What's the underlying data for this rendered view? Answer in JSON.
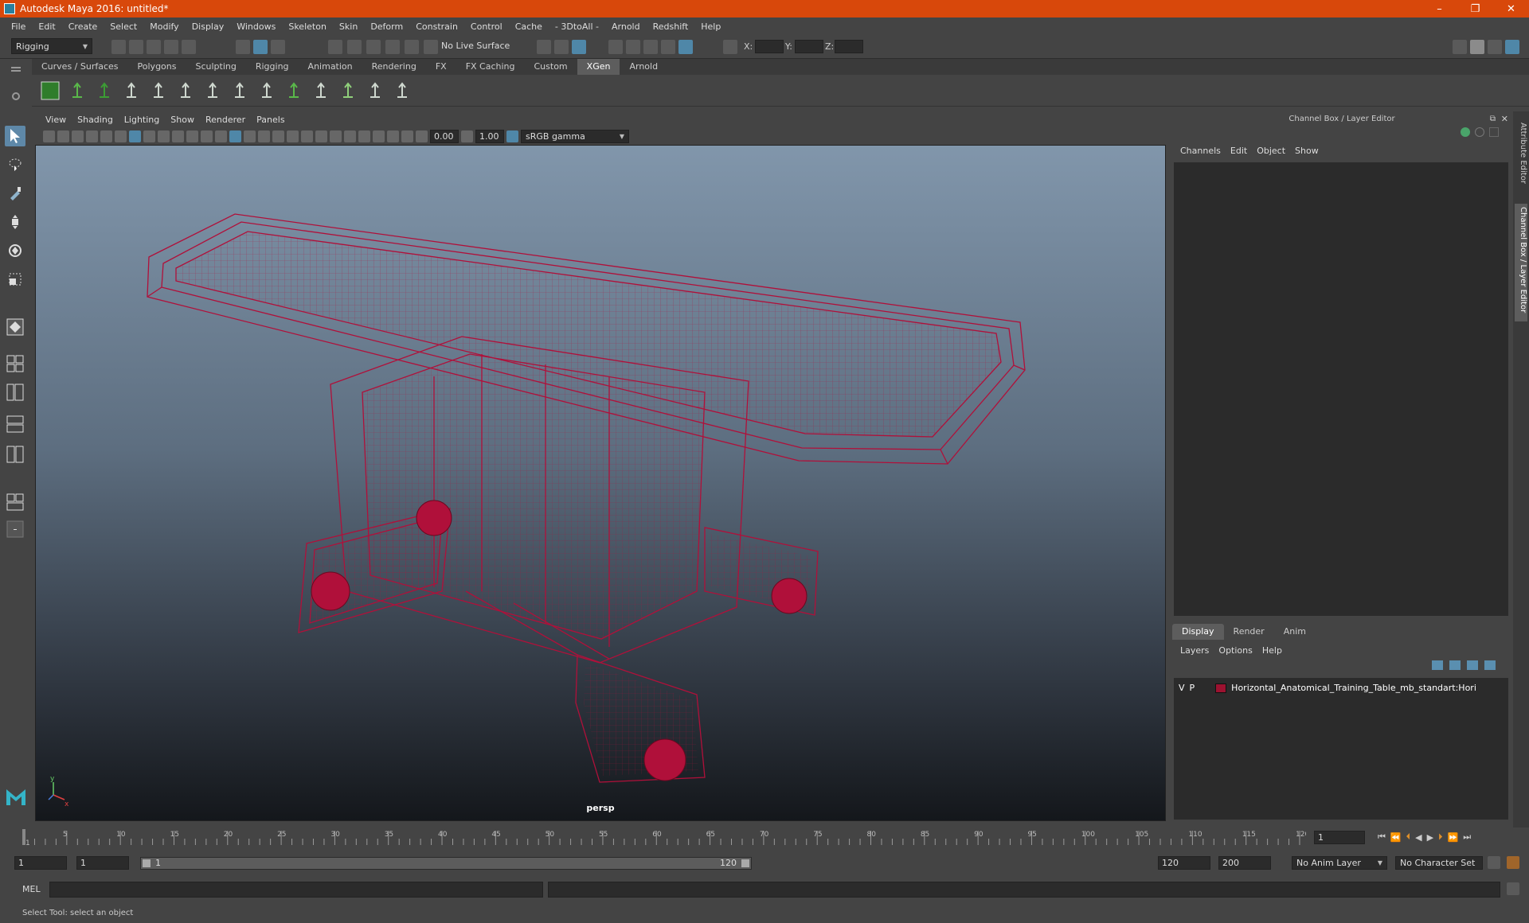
{
  "window": {
    "title": "Autodesk Maya 2016: untitled*",
    "minimize": "–",
    "restore": "❐",
    "close": "✕"
  },
  "menu": [
    "File",
    "Edit",
    "Create",
    "Select",
    "Modify",
    "Display",
    "Windows",
    "Skeleton",
    "Skin",
    "Deform",
    "Constrain",
    "Control",
    "Cache",
    "- 3DtoAll -",
    "Arnold",
    "Redshift",
    "Help"
  ],
  "status_line": {
    "menu_set": "Rigging",
    "live_surface": "No Live Surface",
    "x_label": "X:",
    "y_label": "Y:",
    "z_label": "Z:"
  },
  "shelf_tabs": [
    {
      "label": "Curves / Surfaces",
      "active": false
    },
    {
      "label": "Polygons",
      "active": false
    },
    {
      "label": "Sculpting",
      "active": false
    },
    {
      "label": "Rigging",
      "active": false
    },
    {
      "label": "Animation",
      "active": false
    },
    {
      "label": "Rendering",
      "active": false
    },
    {
      "label": "FX",
      "active": false
    },
    {
      "label": "FX Caching",
      "active": false
    },
    {
      "label": "Custom",
      "active": false
    },
    {
      "label": "XGen",
      "active": true
    },
    {
      "label": "Arnold",
      "active": false
    }
  ],
  "shelf_icons": [
    "xgen-editor-icon",
    "xgen-preview-icon",
    "xgen-description-icon",
    "add-guide-icon",
    "append-guide-icon",
    "guide-normal-icon",
    "sculpt-guide-icon",
    "lock-guide-icon",
    "guide-tools-icon",
    "region-map-icon",
    "groom-icon",
    "clumping-icon",
    "cut-icon",
    "noise-icon"
  ],
  "viewport": {
    "menu": [
      "View",
      "Shading",
      "Lighting",
      "Show",
      "Renderer",
      "Panels"
    ],
    "exposure": "0.00",
    "gamma": "1.00",
    "color_space": "sRGB gamma",
    "camera": "persp",
    "wire_color": "#b0103a"
  },
  "channel_box": {
    "header": "Channel Box / Layer Editor",
    "menu": [
      "Channels",
      "Edit",
      "Object",
      "Show"
    ]
  },
  "layer_editor": {
    "tabs": [
      {
        "label": "Display",
        "active": true
      },
      {
        "label": "Render",
        "active": false
      },
      {
        "label": "Anim",
        "active": false
      }
    ],
    "menu": [
      "Layers",
      "Options",
      "Help"
    ],
    "layers": [
      {
        "visible": "V",
        "playback": "P",
        "color": "#9c1230",
        "name": "Horizontal_Anatomical_Training_Table_mb_standart:Hori"
      }
    ]
  },
  "side_tabs": [
    "Attribute Editor",
    "Channel Box / Layer Editor"
  ],
  "timeline": {
    "ticks": [
      1,
      5,
      10,
      15,
      20,
      25,
      30,
      35,
      40,
      45,
      50,
      55,
      60,
      65,
      70,
      75,
      80,
      85,
      90,
      95,
      100,
      105,
      110,
      115,
      120
    ],
    "current_frame": "1"
  },
  "range": {
    "start": "1",
    "playback_start": "1",
    "range_start": "1",
    "range_end": "120",
    "playback_end": "120",
    "end": "200",
    "anim_layer": "No Anim Layer",
    "character_set": "No Character Set"
  },
  "command_line": {
    "label": "MEL"
  },
  "help_line": "Select Tool: select an object"
}
